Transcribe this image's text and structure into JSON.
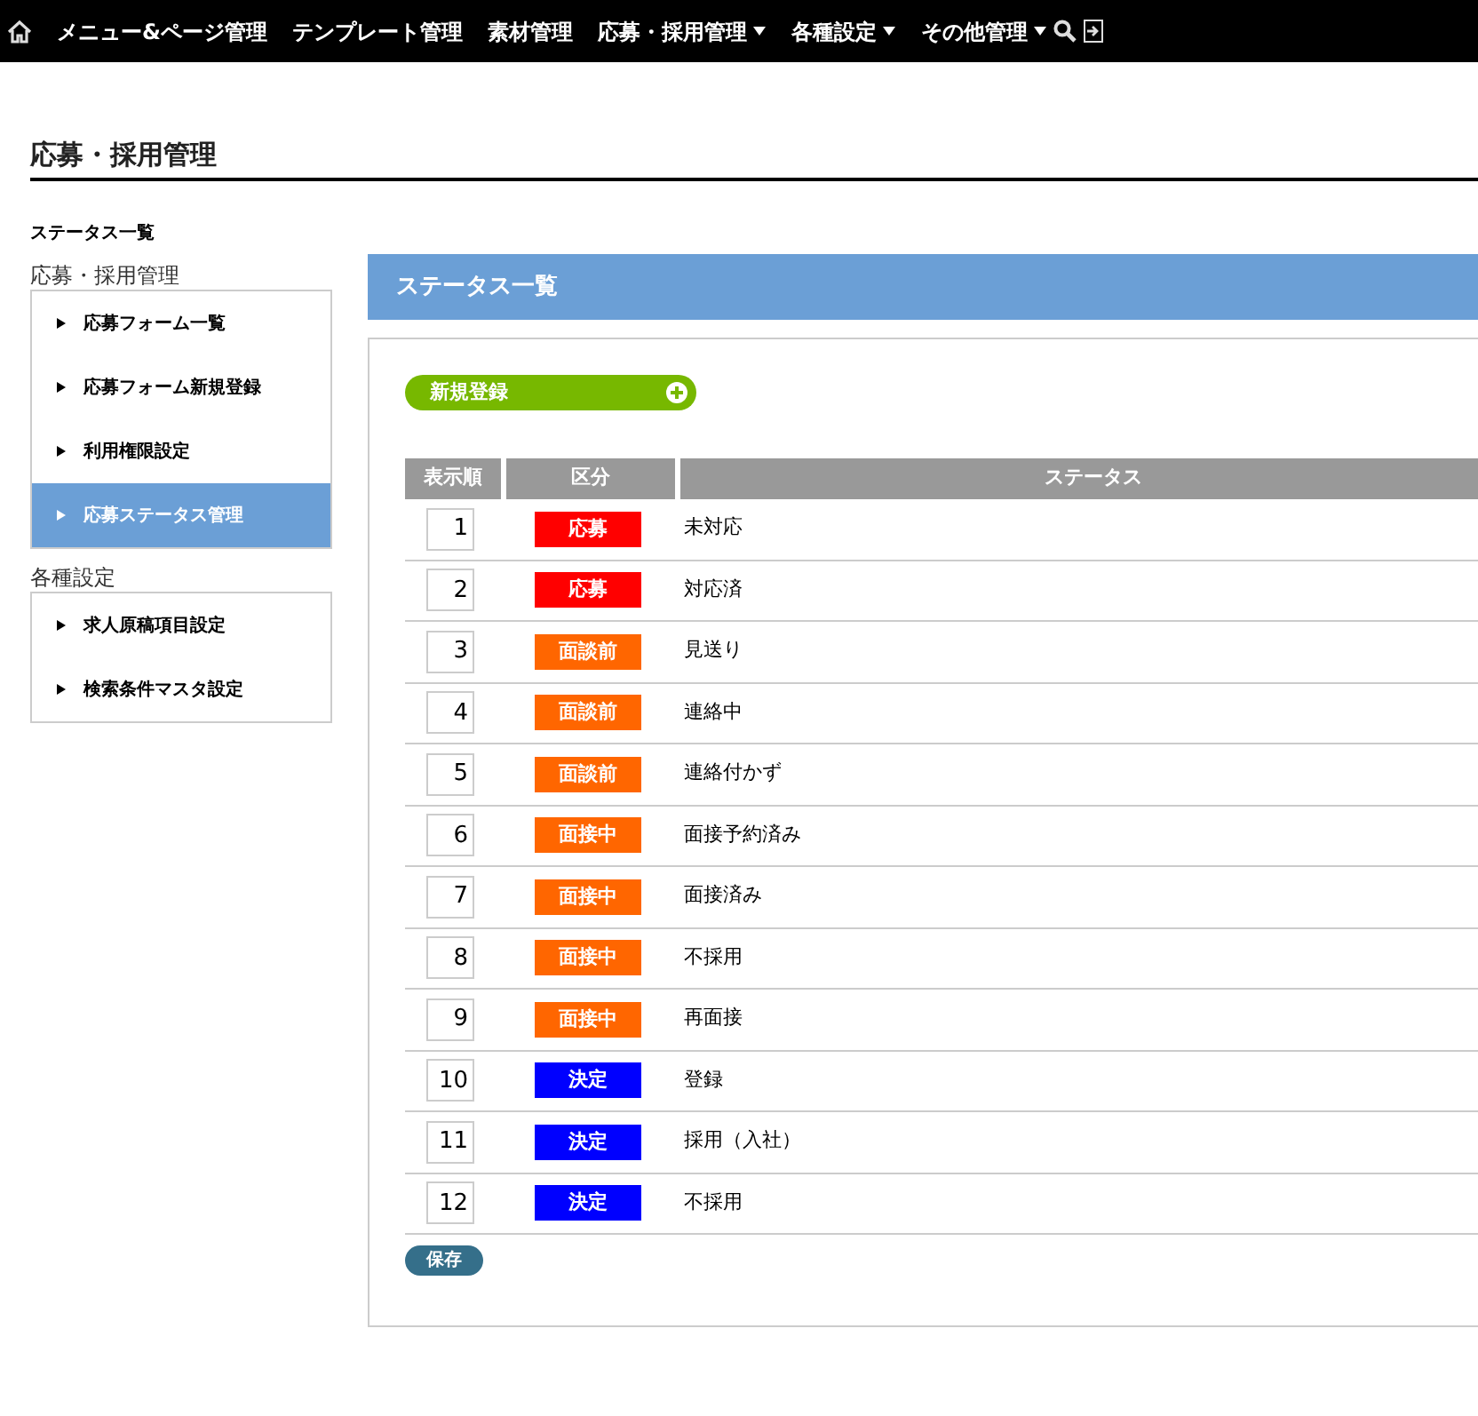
{
  "nav": [
    {
      "label": "メニュー&ページ管理",
      "dropdown": false
    },
    {
      "label": "テンプレート管理",
      "dropdown": false
    },
    {
      "label": "素材管理",
      "dropdown": false
    },
    {
      "label": "応募・採用管理",
      "dropdown": true
    },
    {
      "label": "各種設定",
      "dropdown": true
    },
    {
      "label": "その他管理",
      "dropdown": true
    }
  ],
  "page_title": "応募・採用管理",
  "breadcrumb": "ステータス一覧",
  "sidebar": [
    {
      "heading": "応募・採用管理",
      "items": [
        {
          "label": "応募フォーム一覧",
          "selected": false
        },
        {
          "label": "応募フォーム新規登録",
          "selected": false
        },
        {
          "label": "利用権限設定",
          "selected": false
        },
        {
          "label": "応募ステータス管理",
          "selected": true
        }
      ]
    },
    {
      "heading": "各種設定",
      "items": [
        {
          "label": "求人原稿項目設定",
          "selected": false
        },
        {
          "label": "検索条件マスタ設定",
          "selected": false
        }
      ]
    }
  ],
  "panel_title": "ステータス一覧",
  "new_button": "新規登録",
  "table": {
    "columns": [
      "表示順",
      "区分",
      "ステータス"
    ],
    "rows": [
      {
        "order": "1",
        "category": "応募",
        "color": "#ff0000",
        "status": "未対応"
      },
      {
        "order": "2",
        "category": "応募",
        "color": "#ff0000",
        "status": "対応済"
      },
      {
        "order": "3",
        "category": "面談前",
        "color": "#ff6600",
        "status": "見送り"
      },
      {
        "order": "4",
        "category": "面談前",
        "color": "#ff6600",
        "status": "連絡中"
      },
      {
        "order": "5",
        "category": "面談前",
        "color": "#ff6600",
        "status": "連絡付かず"
      },
      {
        "order": "6",
        "category": "面接中",
        "color": "#ff6600",
        "status": "面接予約済み"
      },
      {
        "order": "7",
        "category": "面接中",
        "color": "#ff6600",
        "status": "面接済み"
      },
      {
        "order": "8",
        "category": "面接中",
        "color": "#ff6600",
        "status": "不採用"
      },
      {
        "order": "9",
        "category": "面接中",
        "color": "#ff6600",
        "status": "再面接"
      },
      {
        "order": "10",
        "category": "決定",
        "color": "#0000ff",
        "status": "登録"
      },
      {
        "order": "11",
        "category": "決定",
        "color": "#0000ff",
        "status": "採用（入社）"
      },
      {
        "order": "12",
        "category": "決定",
        "color": "#0000ff",
        "status": "不採用"
      }
    ]
  },
  "save_button": "保存"
}
